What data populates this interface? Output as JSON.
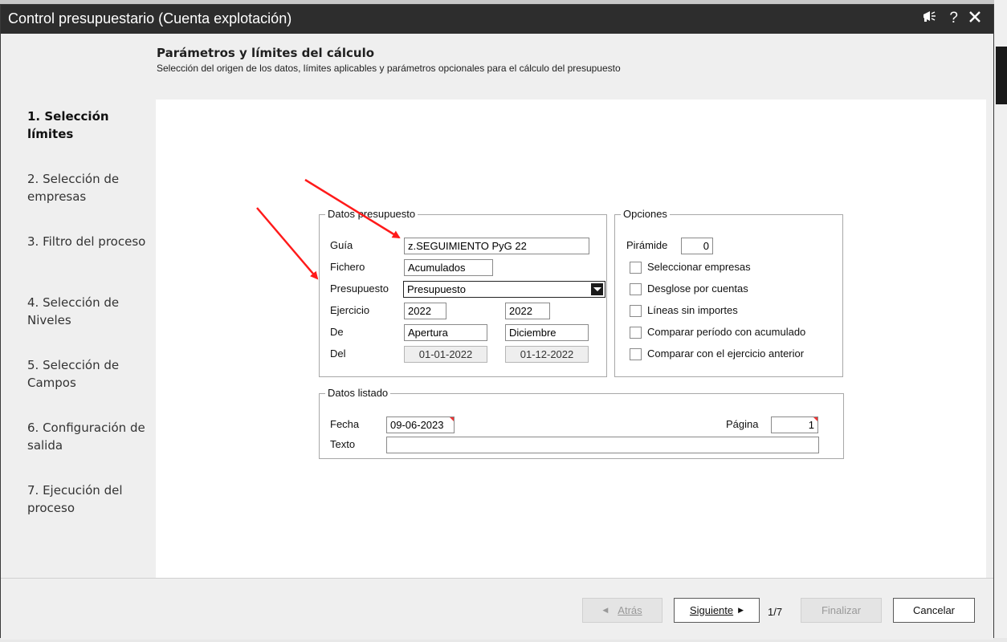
{
  "window": {
    "title": "Control presupuestario (Cuenta explotación)"
  },
  "header": {
    "title": "Parámetros y límites del cálculo",
    "subtitle": "Selección del origen de los datos, límites aplicables y parámetros opcionales para el cálculo del presupuesto"
  },
  "steps": [
    {
      "label": "1. Selección límites",
      "active": true
    },
    {
      "label": "2. Selección de empresas"
    },
    {
      "label": "3. Filtro del proceso"
    },
    {
      "label": "4. Selección de Niveles"
    },
    {
      "label": "5. Selección de Campos"
    },
    {
      "label": "6. Configuración de salida"
    },
    {
      "label": "7. Ejecución del proceso"
    }
  ],
  "datos_presupuesto": {
    "legend": "Datos presupuesto",
    "guia_label": "Guía",
    "guia_value": "z.SEGUIMIENTO PyG 22",
    "fichero_label": "Fichero",
    "fichero_value": "Acumulados",
    "presupuesto_label": "Presupuesto",
    "presupuesto_value": "Presupuesto",
    "ejercicio_label": "Ejercicio",
    "ejercicio_from": "2022",
    "ejercicio_to": "2022",
    "de_label": "De",
    "de_from": "Apertura",
    "de_to": "Diciembre",
    "del_label": "Del",
    "del_from": "01-01-2022",
    "del_to": "01-12-2022"
  },
  "opciones": {
    "legend": "Opciones",
    "piramide_label": "Pirámide",
    "piramide_value": "0",
    "checkboxes": [
      {
        "label": "Seleccionar empresas",
        "checked": false
      },
      {
        "label": "Desglose por cuentas",
        "checked": false
      },
      {
        "label": "Líneas sin importes",
        "checked": false
      },
      {
        "label": "Comparar período con acumulado",
        "checked": false
      },
      {
        "label": "Comparar con el ejercicio anterior",
        "checked": false
      }
    ]
  },
  "datos_listado": {
    "legend": "Datos listado",
    "fecha_label": "Fecha",
    "fecha_value": "09-06-2023",
    "pagina_label": "Página",
    "pagina_value": "1",
    "texto_label": "Texto",
    "texto_value": ""
  },
  "footer": {
    "back": "Atrás",
    "next": "Siguiente",
    "page": "1/7",
    "finish": "Finalizar",
    "cancel": "Cancelar"
  },
  "colors": {
    "titlebar": "#2d2d2d",
    "annotation_arrow": "#ff0000"
  }
}
